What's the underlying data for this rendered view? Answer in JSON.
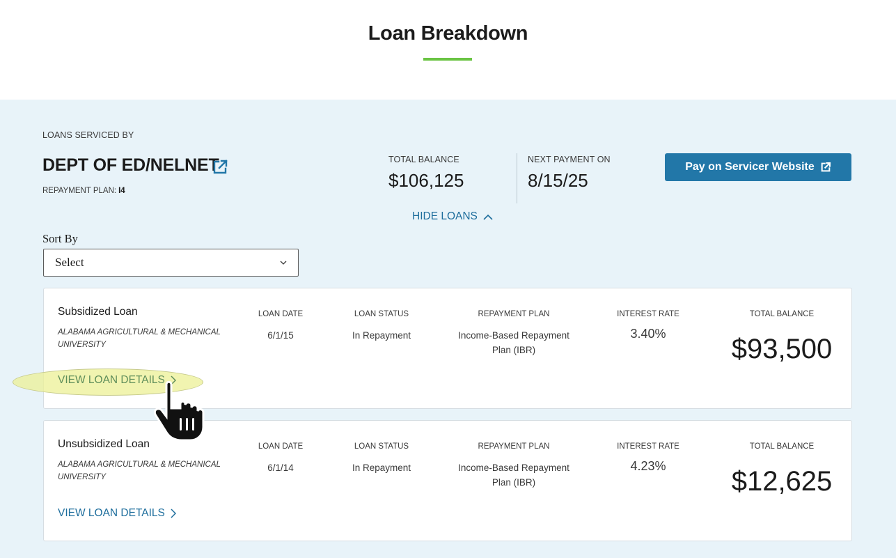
{
  "page": {
    "title": "Loan Breakdown",
    "accent_color": "#6ac443",
    "band_color": "#e8f3f9",
    "link_color": "#1d6d9c"
  },
  "servicer": {
    "label": "LOANS SERVICED BY",
    "name": "DEPT OF ED/NELNET",
    "link_icon": "external-link-icon",
    "plan_label": "REPAYMENT PLAN:",
    "plan_value": "I4"
  },
  "summary": {
    "total_balance_label": "TOTAL BALANCE",
    "total_balance_value": "$106,125",
    "next_payment_label": "NEXT PAYMENT ON",
    "next_payment_value": "8/15/25"
  },
  "pay_button": {
    "label": "Pay on Servicer Website",
    "color": "#2277a8",
    "icon": "external-link-icon"
  },
  "hide_loans": {
    "label": "HIDE LOANS",
    "icon": "chevron-up-icon"
  },
  "sort": {
    "label": "Sort By",
    "selected": "Select",
    "icon": "chevron-down-icon"
  },
  "loans": [
    {
      "type": "Subsidized Loan",
      "school": "ALABAMA AGRICULTURAL & MECHANICAL UNIVERSITY",
      "loan_date_label": "LOAN DATE",
      "loan_date": "6/1/15",
      "status_label": "LOAN STATUS",
      "status": "In Repayment",
      "plan_label": "REPAYMENT PLAN",
      "plan": "Income-Based Repayment Plan (IBR)",
      "rate_label": "INTEREST RATE",
      "rate": "3.40%",
      "balance_label": "TOTAL BALANCE",
      "balance": "$93,500",
      "details_label": "VIEW LOAN DETAILS"
    },
    {
      "type": "Unsubsidized Loan",
      "school": "ALABAMA AGRICULTURAL & MECHANICAL UNIVERSITY",
      "loan_date_label": "LOAN DATE",
      "loan_date": "6/1/14",
      "status_label": "LOAN STATUS",
      "status": "In Repayment",
      "plan_label": "REPAYMENT PLAN",
      "plan": "Income-Based Repayment Plan (IBR)",
      "rate_label": "INTEREST RATE",
      "rate": "4.23%",
      "balance_label": "TOTAL BALANCE",
      "balance": "$12,625",
      "details_label": "VIEW LOAN DETAILS"
    }
  ],
  "overlay": {
    "highlight_color": "#ecf096",
    "pointer_icon": "hand-pointer-icon"
  }
}
